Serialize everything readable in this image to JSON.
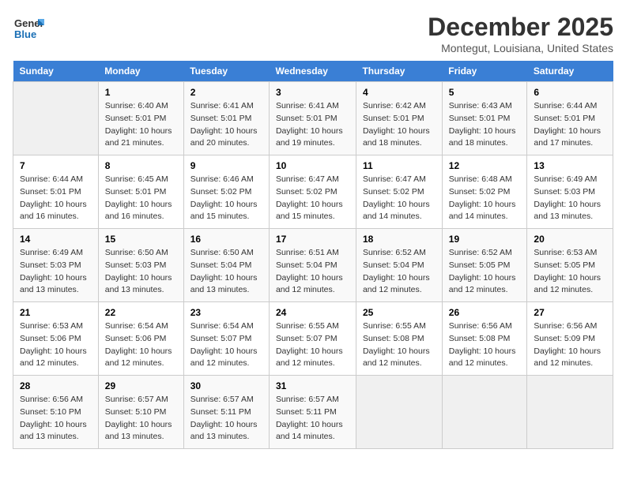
{
  "header": {
    "logo_general": "General",
    "logo_blue": "Blue",
    "title": "December 2025",
    "subtitle": "Montegut, Louisiana, United States"
  },
  "days_of_week": [
    "Sunday",
    "Monday",
    "Tuesday",
    "Wednesday",
    "Thursday",
    "Friday",
    "Saturday"
  ],
  "weeks": [
    [
      {
        "num": "",
        "sunrise": "",
        "sunset": "",
        "daylight": ""
      },
      {
        "num": "1",
        "sunrise": "Sunrise: 6:40 AM",
        "sunset": "Sunset: 5:01 PM",
        "daylight": "Daylight: 10 hours and 21 minutes."
      },
      {
        "num": "2",
        "sunrise": "Sunrise: 6:41 AM",
        "sunset": "Sunset: 5:01 PM",
        "daylight": "Daylight: 10 hours and 20 minutes."
      },
      {
        "num": "3",
        "sunrise": "Sunrise: 6:41 AM",
        "sunset": "Sunset: 5:01 PM",
        "daylight": "Daylight: 10 hours and 19 minutes."
      },
      {
        "num": "4",
        "sunrise": "Sunrise: 6:42 AM",
        "sunset": "Sunset: 5:01 PM",
        "daylight": "Daylight: 10 hours and 18 minutes."
      },
      {
        "num": "5",
        "sunrise": "Sunrise: 6:43 AM",
        "sunset": "Sunset: 5:01 PM",
        "daylight": "Daylight: 10 hours and 18 minutes."
      },
      {
        "num": "6",
        "sunrise": "Sunrise: 6:44 AM",
        "sunset": "Sunset: 5:01 PM",
        "daylight": "Daylight: 10 hours and 17 minutes."
      }
    ],
    [
      {
        "num": "7",
        "sunrise": "Sunrise: 6:44 AM",
        "sunset": "Sunset: 5:01 PM",
        "daylight": "Daylight: 10 hours and 16 minutes."
      },
      {
        "num": "8",
        "sunrise": "Sunrise: 6:45 AM",
        "sunset": "Sunset: 5:01 PM",
        "daylight": "Daylight: 10 hours and 16 minutes."
      },
      {
        "num": "9",
        "sunrise": "Sunrise: 6:46 AM",
        "sunset": "Sunset: 5:02 PM",
        "daylight": "Daylight: 10 hours and 15 minutes."
      },
      {
        "num": "10",
        "sunrise": "Sunrise: 6:47 AM",
        "sunset": "Sunset: 5:02 PM",
        "daylight": "Daylight: 10 hours and 15 minutes."
      },
      {
        "num": "11",
        "sunrise": "Sunrise: 6:47 AM",
        "sunset": "Sunset: 5:02 PM",
        "daylight": "Daylight: 10 hours and 14 minutes."
      },
      {
        "num": "12",
        "sunrise": "Sunrise: 6:48 AM",
        "sunset": "Sunset: 5:02 PM",
        "daylight": "Daylight: 10 hours and 14 minutes."
      },
      {
        "num": "13",
        "sunrise": "Sunrise: 6:49 AM",
        "sunset": "Sunset: 5:03 PM",
        "daylight": "Daylight: 10 hours and 13 minutes."
      }
    ],
    [
      {
        "num": "14",
        "sunrise": "Sunrise: 6:49 AM",
        "sunset": "Sunset: 5:03 PM",
        "daylight": "Daylight: 10 hours and 13 minutes."
      },
      {
        "num": "15",
        "sunrise": "Sunrise: 6:50 AM",
        "sunset": "Sunset: 5:03 PM",
        "daylight": "Daylight: 10 hours and 13 minutes."
      },
      {
        "num": "16",
        "sunrise": "Sunrise: 6:50 AM",
        "sunset": "Sunset: 5:04 PM",
        "daylight": "Daylight: 10 hours and 13 minutes."
      },
      {
        "num": "17",
        "sunrise": "Sunrise: 6:51 AM",
        "sunset": "Sunset: 5:04 PM",
        "daylight": "Daylight: 10 hours and 12 minutes."
      },
      {
        "num": "18",
        "sunrise": "Sunrise: 6:52 AM",
        "sunset": "Sunset: 5:04 PM",
        "daylight": "Daylight: 10 hours and 12 minutes."
      },
      {
        "num": "19",
        "sunrise": "Sunrise: 6:52 AM",
        "sunset": "Sunset: 5:05 PM",
        "daylight": "Daylight: 10 hours and 12 minutes."
      },
      {
        "num": "20",
        "sunrise": "Sunrise: 6:53 AM",
        "sunset": "Sunset: 5:05 PM",
        "daylight": "Daylight: 10 hours and 12 minutes."
      }
    ],
    [
      {
        "num": "21",
        "sunrise": "Sunrise: 6:53 AM",
        "sunset": "Sunset: 5:06 PM",
        "daylight": "Daylight: 10 hours and 12 minutes."
      },
      {
        "num": "22",
        "sunrise": "Sunrise: 6:54 AM",
        "sunset": "Sunset: 5:06 PM",
        "daylight": "Daylight: 10 hours and 12 minutes."
      },
      {
        "num": "23",
        "sunrise": "Sunrise: 6:54 AM",
        "sunset": "Sunset: 5:07 PM",
        "daylight": "Daylight: 10 hours and 12 minutes."
      },
      {
        "num": "24",
        "sunrise": "Sunrise: 6:55 AM",
        "sunset": "Sunset: 5:07 PM",
        "daylight": "Daylight: 10 hours and 12 minutes."
      },
      {
        "num": "25",
        "sunrise": "Sunrise: 6:55 AM",
        "sunset": "Sunset: 5:08 PM",
        "daylight": "Daylight: 10 hours and 12 minutes."
      },
      {
        "num": "26",
        "sunrise": "Sunrise: 6:56 AM",
        "sunset": "Sunset: 5:08 PM",
        "daylight": "Daylight: 10 hours and 12 minutes."
      },
      {
        "num": "27",
        "sunrise": "Sunrise: 6:56 AM",
        "sunset": "Sunset: 5:09 PM",
        "daylight": "Daylight: 10 hours and 12 minutes."
      }
    ],
    [
      {
        "num": "28",
        "sunrise": "Sunrise: 6:56 AM",
        "sunset": "Sunset: 5:10 PM",
        "daylight": "Daylight: 10 hours and 13 minutes."
      },
      {
        "num": "29",
        "sunrise": "Sunrise: 6:57 AM",
        "sunset": "Sunset: 5:10 PM",
        "daylight": "Daylight: 10 hours and 13 minutes."
      },
      {
        "num": "30",
        "sunrise": "Sunrise: 6:57 AM",
        "sunset": "Sunset: 5:11 PM",
        "daylight": "Daylight: 10 hours and 13 minutes."
      },
      {
        "num": "31",
        "sunrise": "Sunrise: 6:57 AM",
        "sunset": "Sunset: 5:11 PM",
        "daylight": "Daylight: 10 hours and 14 minutes."
      },
      {
        "num": "",
        "sunrise": "",
        "sunset": "",
        "daylight": ""
      },
      {
        "num": "",
        "sunrise": "",
        "sunset": "",
        "daylight": ""
      },
      {
        "num": "",
        "sunrise": "",
        "sunset": "",
        "daylight": ""
      }
    ]
  ]
}
